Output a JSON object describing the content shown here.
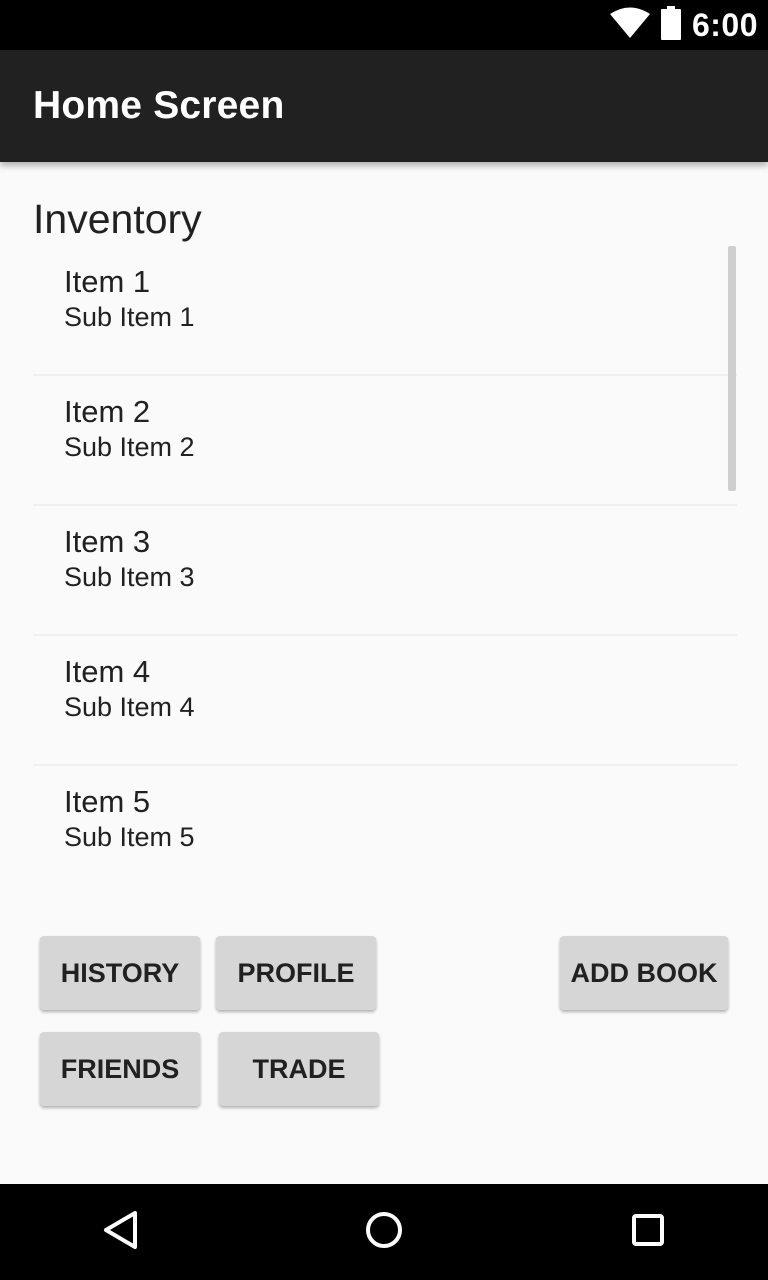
{
  "status_bar": {
    "time": "6:00",
    "icons": [
      "wifi-icon",
      "battery-icon"
    ]
  },
  "app_bar": {
    "title": "Home Screen"
  },
  "inventory": {
    "title": "Inventory",
    "items": [
      {
        "title": "Item 1",
        "subtitle": "Sub Item 1"
      },
      {
        "title": "Item 2",
        "subtitle": "Sub Item 2"
      },
      {
        "title": "Item 3",
        "subtitle": "Sub Item 3"
      },
      {
        "title": "Item 4",
        "subtitle": "Sub Item 4"
      },
      {
        "title": "Item 5",
        "subtitle": "Sub Item 5"
      }
    ]
  },
  "buttons": {
    "history": "HISTORY",
    "profile": "PROFILE",
    "add_book": "ADD BOOK",
    "friends": "FRIENDS",
    "trade": "TRADE"
  },
  "nav_bar": {
    "icons": [
      "back-icon",
      "home-icon",
      "recents-icon"
    ]
  },
  "colors": {
    "app_bar": "#212121",
    "status_bar": "#000000",
    "button": "#d6d6d6",
    "background": "#fafafa"
  }
}
